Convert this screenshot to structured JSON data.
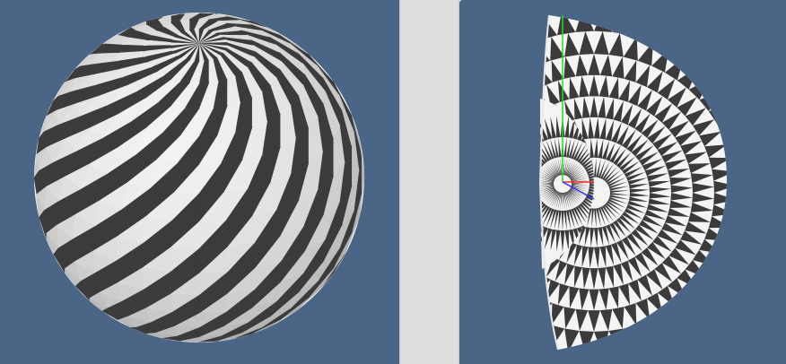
{
  "app": {
    "background_color": "#4a6585",
    "splitter_color": "#dddddd"
  },
  "left_view": {
    "object": "sphere",
    "shading": "checkered-triangle-mesh",
    "light_color": "#f4f4f4",
    "dark_color": "#3b3b3b"
  },
  "right_view": {
    "object": "cut-sphere",
    "shading": "checkered-triangle-mesh",
    "light_color": "#f4f4f4",
    "dark_color": "#3b3b3b",
    "axes": {
      "x_color": "#ff2a2a",
      "y_color": "#22dd22",
      "z_color": "#3333ff"
    }
  }
}
